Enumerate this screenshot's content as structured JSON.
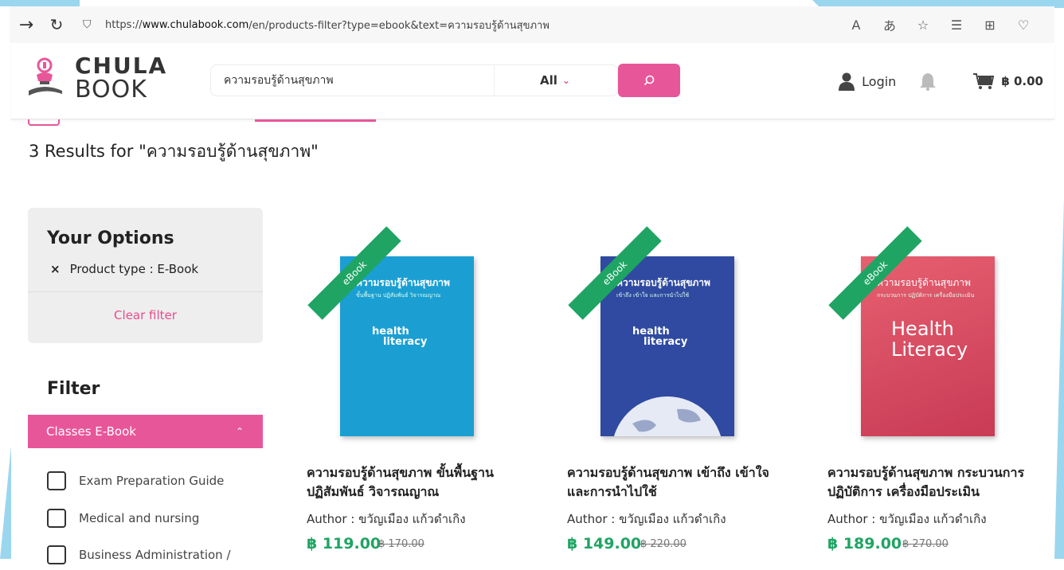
{
  "browser": {
    "url_prefix": "https://",
    "url_host": "www.chulabook.com",
    "url_path": "/en/products-filter?type=ebook&text=ความรอบรู้ด้านสุขภาพ",
    "icons": [
      "read-aloud-icon",
      "translate-icon",
      "add-favorite-icon",
      "favorites-icon",
      "collections-icon",
      "health-icon"
    ]
  },
  "header": {
    "logo_line1": "CHULA",
    "logo_line2": "BOOK",
    "search_value": "ความรอบรู้ด้านสุขภาพ",
    "category": "All",
    "login": "Login",
    "cart_total": "฿ 0.00"
  },
  "results": {
    "title": "3 Results for \"ความรอบรู้ด้านสุขภาพ\""
  },
  "options": {
    "heading": "Your Options",
    "chip_x": "×",
    "chip": "Product type : E-Book",
    "clear": "Clear filter"
  },
  "filter": {
    "heading": "Filter",
    "section": "Classes E-Book",
    "items": [
      "Exam Preparation Guide",
      "Medical and nursing",
      "Business Administration /"
    ]
  },
  "products": [
    {
      "ribbon": "eBook",
      "cover_title": "ความรอบรู้ด้านสุขภาพ",
      "cover_subtitle": "ขั้นพื้นฐาน ปฏิสัมพันธ์ วิจารณญาณ",
      "cover_hl1": "health",
      "cover_hl2": "literacy",
      "cover_color": "#1b9fd3",
      "title": "ความรอบรู้ด้านสุขภาพ ขั้นพื้นฐาน ปฏิสัมพันธ์ วิจารณญาณ",
      "author": "Author : ขวัญเมือง แก้วดำเกิง",
      "price": "฿ 119.00",
      "old_price": "฿ 170.00"
    },
    {
      "ribbon": "eBook",
      "cover_title": "ความรอบรู้ด้านสุขภาพ",
      "cover_subtitle": "เข้าถึง เข้าใจ และการนำไปใช้",
      "cover_hl1": "health",
      "cover_hl2": "literacy",
      "cover_color": "#2f4aa0",
      "title": "ความรอบรู้ด้านสุขภาพ เข้าถึง เข้าใจ และการนำไปใช้",
      "author": "Author : ขวัญเมือง แก้วดำเกิง",
      "price": "฿ 149.00",
      "old_price": "฿ 220.00"
    },
    {
      "ribbon": "eBook",
      "cover_title": "ความรอบรู้ด้านสุขภาพ",
      "cover_subtitle": "กระบวนการ ปฏิบัติการ เครื่องมือประเมิน",
      "cover_hl1": "Health",
      "cover_hl2": "Literacy",
      "cover_color": "#d84a5c",
      "title": "ความรอบรู้ด้านสุขภาพ กระบวนการ ปฏิบัติการ เครื่องมือประเมิน",
      "author": "Author : ขวัญเมือง แก้วดำเกิง",
      "price": "฿ 189.00",
      "old_price": "฿ 270.00"
    }
  ],
  "colors": {
    "accent_pink": "#e8569a",
    "price_green": "#1fa463",
    "frame_blue": "#8fd3ee"
  }
}
